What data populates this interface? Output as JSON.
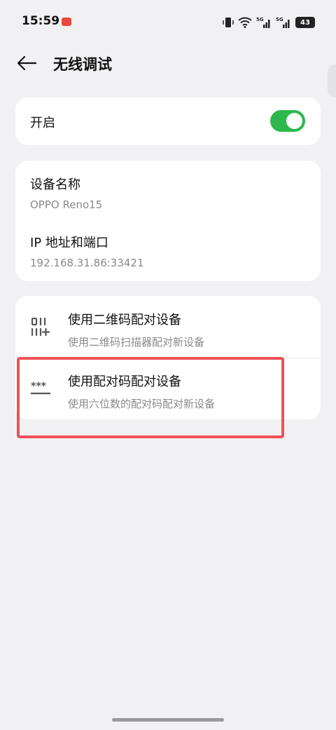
{
  "status_bar": {
    "time": "15:59",
    "network_1": "5G",
    "network_2": "5G",
    "battery": "43"
  },
  "header": {
    "title": "无线调试"
  },
  "toggle_card": {
    "label": "开启",
    "enabled": true,
    "accent_color": "#2db84d"
  },
  "device_info": {
    "name_label": "设备名称",
    "name_value": "OPPO Reno15",
    "ip_label": "IP 地址和端口",
    "ip_value": "192.168.31.86:33421"
  },
  "pairing": {
    "items": [
      {
        "icon": "qr-code-icon",
        "title": "使用二维码配对设备",
        "subtitle": "使用二维码扫描器配对新设备"
      },
      {
        "icon": "pairing-code-icon",
        "title": "使用配对码配对设备",
        "subtitle": "使用六位数的配对码配对新设备"
      }
    ]
  },
  "colors": {
    "highlight": "#f05156",
    "background": "#f1f1f3"
  }
}
